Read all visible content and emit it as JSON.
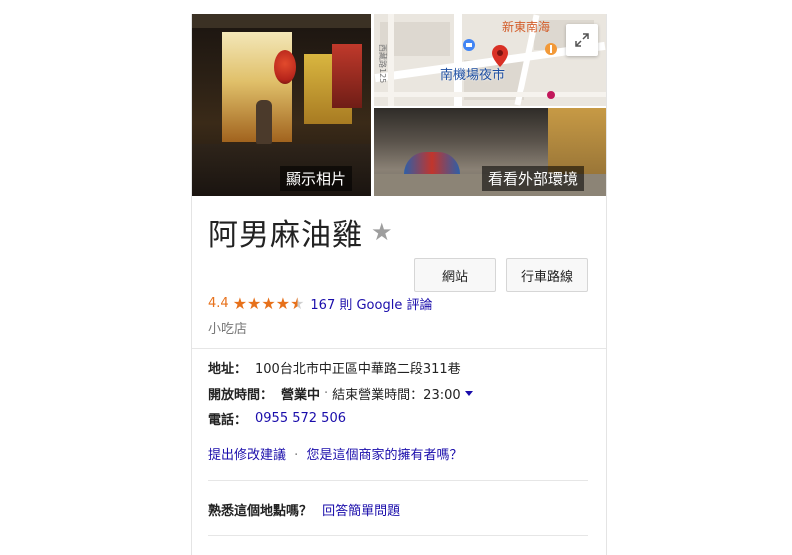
{
  "photos": {
    "show_photos_label": "顯示相片",
    "see_outside_label": "看看外部環境"
  },
  "map": {
    "place_label": "南機場夜市",
    "nearby_label": "新東南海",
    "street_label": "西藏路125",
    "pin_color": "#d93025"
  },
  "place": {
    "name": "阿男麻油雞",
    "category": "小吃店"
  },
  "actions": {
    "website_label": "網站",
    "directions_label": "行車路線"
  },
  "rating": {
    "score": "4.4",
    "stars": 4.4,
    "reviews_label": "167 則 Google 評論",
    "star_color": "#e7711b"
  },
  "info": {
    "address_label": "地址：",
    "address_value": "100台北市中正區中華路二段311巷",
    "hours_label": "開放時間：",
    "hours_status": "營業中",
    "hours_separator": "·",
    "hours_detail": "結束營業時間：23:00",
    "phone_label": "電話：",
    "phone_value": "0955 572 506"
  },
  "footer_links": {
    "suggest_edit": "提出修改建議",
    "separator": "·",
    "own_business": "您是這個商家的擁有者嗎？"
  },
  "know_place": {
    "question": "熟悉這個地點嗎？",
    "answer_link": "回答簡單問題"
  },
  "colors": {
    "link": "#1a0dab",
    "accent_orange": "#e7711b",
    "muted_text": "#777777"
  }
}
